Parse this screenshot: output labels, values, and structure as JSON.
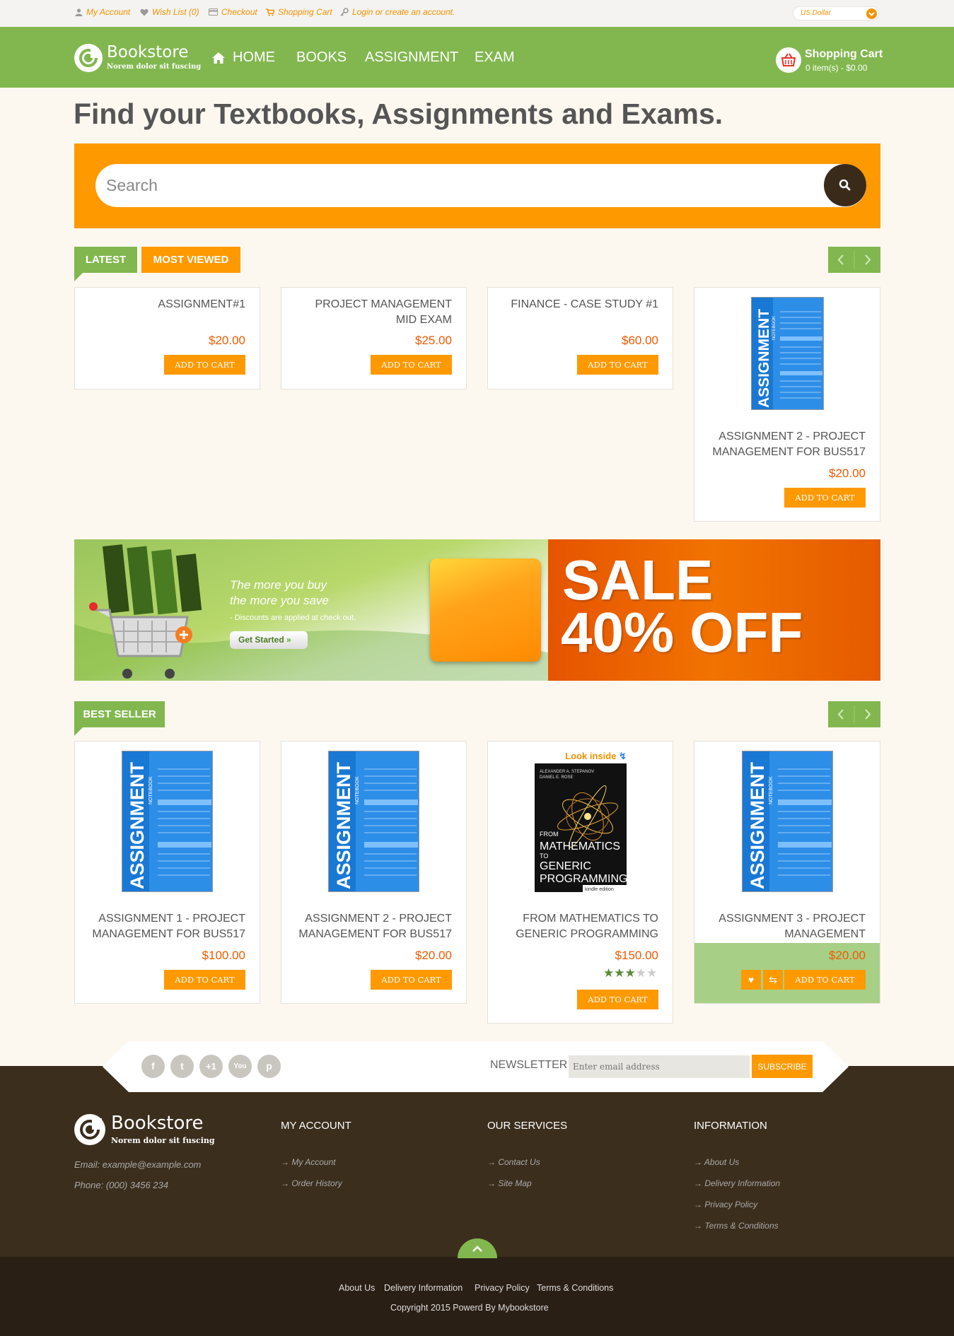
{
  "topbar": {
    "my_account": "My Account",
    "wish_list": "Wish List (0)",
    "checkout": "Checkout",
    "shopping_cart": "Shopping Cart",
    "login": "Login or create an account.",
    "currency": "US Dollar"
  },
  "header": {
    "logo_name": "Bookstore",
    "logo_tagline": "Norem dolor sit fuscing",
    "nav": [
      "HOME",
      "BOOKS",
      "ASSIGNMENT",
      "EXAM"
    ],
    "cart_title": "Shopping Cart",
    "cart_summary": "0 item(s) - $0.00"
  },
  "hero": {
    "title": "Find your Textbooks, Assignments and Exams.",
    "search_placeholder": "Search"
  },
  "latest": {
    "tabs": [
      "LATEST",
      "MOST VIEWED"
    ],
    "products": [
      {
        "name": "ASSIGNMENT#1",
        "price": "$20.00",
        "button": "ADD TO CART"
      },
      {
        "name": "PROJECT MANAGEMENT MID EXAM",
        "price": "$25.00",
        "button": "ADD TO CART"
      },
      {
        "name": "FINANCE - CASE STUDY #1",
        "price": "$60.00",
        "button": "ADD TO CART"
      },
      {
        "name": "ASSIGNMENT 2 - PROJECT MANAGEMENT FOR BUS517",
        "price": "$20.00",
        "button": "ADD TO CART"
      }
    ]
  },
  "banner": {
    "line1": "The more you buy",
    "line2": "the more you save",
    "line3": "- Discounts are applied at check out.",
    "cta": "Get Started",
    "sale_line1": "SALE",
    "sale_line2": "40% OFF"
  },
  "bestseller": {
    "tab": "BEST SELLER",
    "products": [
      {
        "name": "ASSIGNMENT 1 - PROJECT MANAGEMENT FOR BUS517",
        "price": "$100.00",
        "button": "ADD TO CART"
      },
      {
        "name": "ASSIGNMENT 2 - PROJECT MANAGEMENT FOR BUS517",
        "price": "$20.00",
        "button": "ADD TO CART"
      },
      {
        "name": "FROM MATHEMATICS TO GENERIC PROGRAMMING",
        "price": "$150.00",
        "button": "ADD TO CART",
        "rating": 3,
        "rating_max": 5
      },
      {
        "name": "ASSIGNMENT 3 - PROJECT MANAGEMENT",
        "price": "$20.00",
        "button": "ADD TO CART"
      }
    ]
  },
  "book_cover": {
    "notebook_title": "ASSIGNMENT",
    "notebook_sub": "NOTEBOOK",
    "look_inside": "Look inside",
    "authors": "ALEXANDER A. STEPANOV",
    "authors2": "DANIEL E. ROSE",
    "from": "FROM",
    "math": "MATHEMATICS",
    "to": "TO",
    "generic": "GENERIC",
    "programming": "PROGRAMMING",
    "edition": "kindle edition"
  },
  "newsletter": {
    "label": "NEWSLETTER",
    "placeholder": "Enter email address",
    "button": "SUBSCRIBE",
    "social": [
      "f",
      "t",
      "+1",
      "You",
      "p"
    ]
  },
  "footer": {
    "logo_name": "Bookstore",
    "logo_tagline": "Norem dolor sit fuscing",
    "email": "Email: example@example.com",
    "phone": "Phone: (000) 3456 234",
    "my_account": {
      "title": "MY ACCOUNT",
      "links": [
        "My Account",
        "Order History"
      ]
    },
    "our_services": {
      "title": "OUR SERVICES",
      "links": [
        "Contact Us",
        "Site Map"
      ]
    },
    "information": {
      "title": "INFORMATION",
      "links": [
        "About Us",
        "Delivery Information",
        "Privacy Policy",
        "Terms & Conditions"
      ]
    },
    "bottom_links": [
      "About Us",
      "Delivery Information",
      "Privacy Policy",
      "Terms & Conditions"
    ],
    "copyright": "Copyright 2015 Powerd By Mybookstore"
  },
  "colors": {
    "green": "#82b74f",
    "orange": "#ff9900",
    "price": "#f05a00",
    "footer": "#3b2e1d"
  }
}
